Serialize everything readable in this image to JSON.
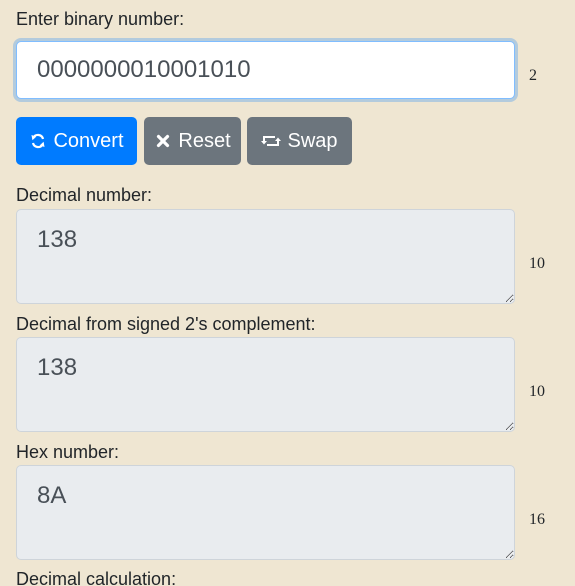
{
  "input_section": {
    "label": "Enter binary number:",
    "value": "0000000010001010",
    "base": "2"
  },
  "buttons": {
    "convert_label": "Convert",
    "convert_icon": "refresh-icon",
    "reset_label": "Reset",
    "reset_icon": "close-icon",
    "swap_label": "Swap",
    "swap_icon": "retweet-icon"
  },
  "outputs": [
    {
      "label": "Decimal number:",
      "value": "138",
      "base": "10"
    },
    {
      "label": "Decimal from signed 2's complement:",
      "value": "138",
      "base": "10"
    },
    {
      "label": "Hex number:",
      "value": "8A",
      "base": "16"
    }
  ],
  "next_section": {
    "label": "Decimal calculation:"
  },
  "colors": {
    "background": "#efe6d2",
    "primary": "#007bff",
    "secondary": "#6c757d",
    "readonly_field": "#e9ecef"
  }
}
